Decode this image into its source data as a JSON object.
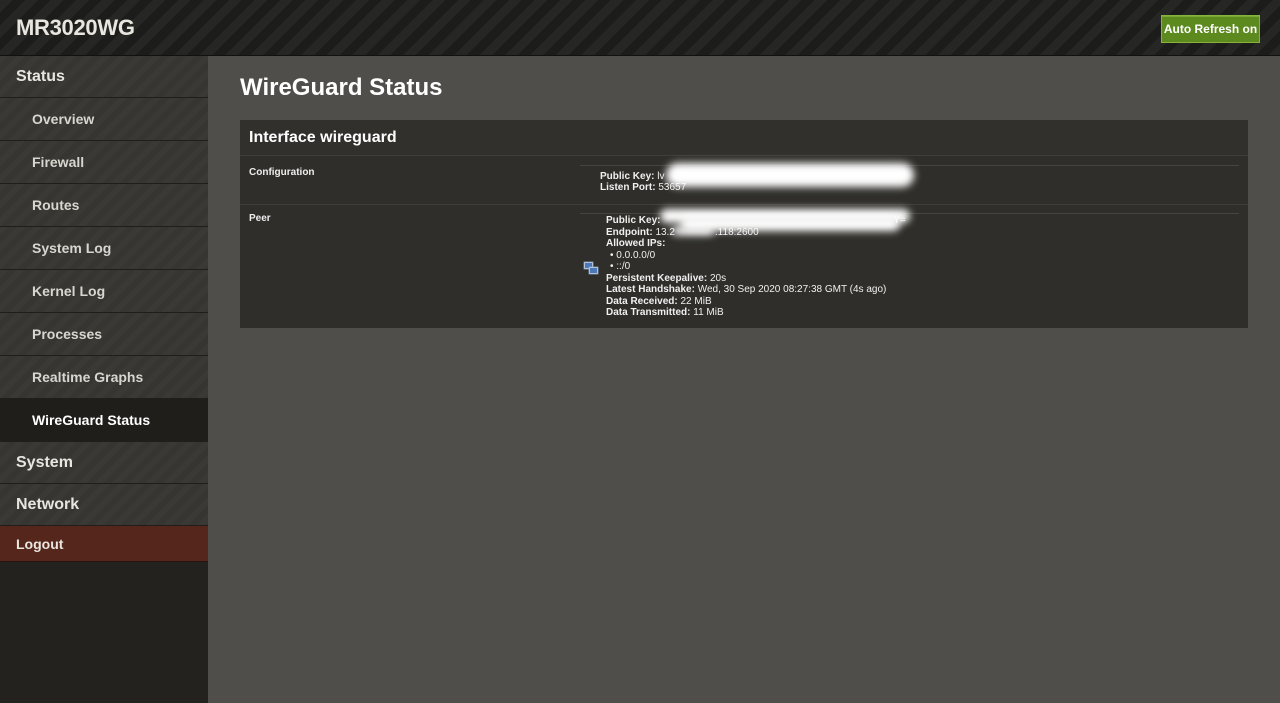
{
  "header": {
    "brand": "MR3020WG",
    "auto_refresh_label": "Auto Refresh on"
  },
  "sidebar": {
    "sections": [
      {
        "label": "Status"
      },
      {
        "label": "System"
      },
      {
        "label": "Network"
      }
    ],
    "status_items": [
      {
        "label": "Overview"
      },
      {
        "label": "Firewall"
      },
      {
        "label": "Routes"
      },
      {
        "label": "System Log"
      },
      {
        "label": "Kernel Log"
      },
      {
        "label": "Processes"
      },
      {
        "label": "Realtime Graphs"
      },
      {
        "label": "WireGuard Status"
      }
    ],
    "logout_label": "Logout"
  },
  "main": {
    "title": "WireGuard Status",
    "panel_title": "Interface wireguard",
    "configuration": {
      "label": "Configuration",
      "public_key_label": "Public Key:",
      "public_key_value": "lv",
      "listen_port_label": "Listen Port:",
      "listen_port_value": "53657"
    },
    "peer": {
      "label": "Peer",
      "icon": "peer-computer-icon",
      "public_key_label": "Public Key:",
      "public_key_value": "Y=",
      "endpoint_label": "Endpoint:",
      "endpoint_value": "13.2",
      "endpoint_value_tail": ".118:2600",
      "allowed_ips_label": "Allowed IPs:",
      "allowed_ips": [
        "0.0.0.0/0",
        "::/0"
      ],
      "keepalive_label": "Persistent Keepalive:",
      "keepalive_value": "20s",
      "handshake_label": "Latest Handshake:",
      "handshake_value": "Wed, 30 Sep 2020 08:27:38 GMT (4s ago)",
      "received_label": "Data Received:",
      "received_value": "22 MiB",
      "transmitted_label": "Data Transmitted:",
      "transmitted_value": "11 MiB"
    }
  }
}
